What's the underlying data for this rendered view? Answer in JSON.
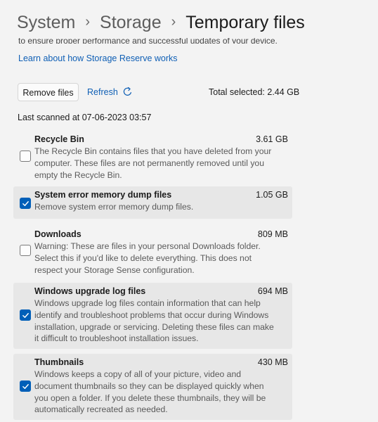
{
  "breadcrumb": {
    "system": "System",
    "storage": "Storage",
    "current": "Temporary files"
  },
  "intro": {
    "cut_text": "to ensure proper performance and successful updates of your device.",
    "learn_link": "Learn about how Storage Reserve works"
  },
  "toolbar": {
    "remove_label": "Remove files",
    "refresh_label": "Refresh",
    "total_selected": "Total selected: 2.44 GB"
  },
  "last_scanned": "Last scanned at 07-06-2023 03:57",
  "items": [
    {
      "title": "Recycle Bin",
      "size": "3.61 GB",
      "checked": false,
      "description": "The Recycle Bin contains files that you have deleted from your computer. These files are not permanently removed until you empty the Recycle Bin."
    },
    {
      "title": "System error memory dump files",
      "size": "1.05 GB",
      "checked": true,
      "description": "Remove system error memory dump files."
    },
    {
      "title": "Downloads",
      "size": "809 MB",
      "checked": false,
      "description": "Warning: These are files in your personal Downloads folder. Select this if you'd like to delete everything. This does not respect your Storage Sense configuration."
    },
    {
      "title": "Windows upgrade log files",
      "size": "694 MB",
      "checked": true,
      "description": "Windows upgrade log files contain information that can help identify and troubleshoot problems that occur during Windows installation, upgrade or servicing. Deleting these files can make it difficult to troubleshoot installation issues."
    },
    {
      "title": "Thumbnails",
      "size": "430 MB",
      "checked": true,
      "description": "Windows keeps a copy of all of your picture, video and document thumbnails so they can be displayed quickly when you open a folder. If you delete these thumbnails, they will be automatically recreated as needed."
    }
  ],
  "colors": {
    "accent": "#005fb8",
    "link": "#0f5fb5",
    "selected_row": "#e7e7e7",
    "background": "#f3f3f3"
  },
  "icons": {
    "separator": "chevron-right-icon",
    "refresh": "refresh-icon",
    "checked": "checkmark-icon"
  }
}
